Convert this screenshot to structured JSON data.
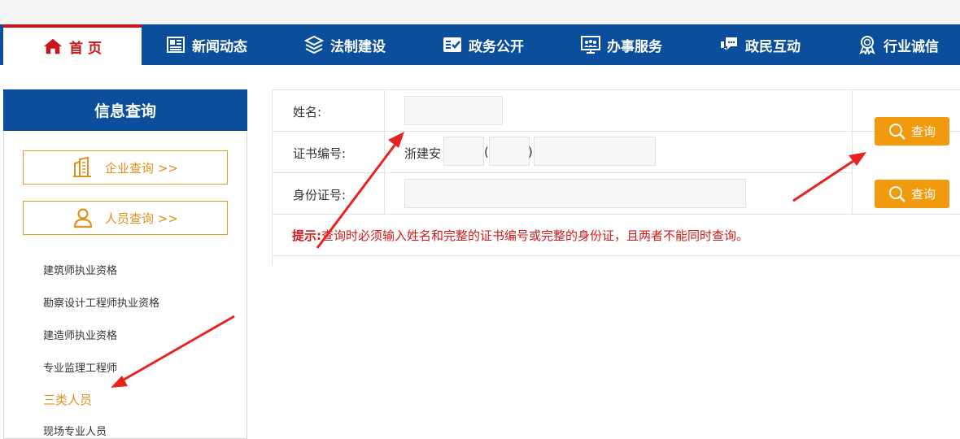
{
  "nav": {
    "items": [
      {
        "label": "首 页",
        "icon": "home-icon"
      },
      {
        "label": "新闻动态",
        "icon": "newspaper-icon"
      },
      {
        "label": "法制建设",
        "icon": "layers-icon"
      },
      {
        "label": "政务公开",
        "icon": "checkbox-card-icon"
      },
      {
        "label": "办事服务",
        "icon": "people-monitor-icon"
      },
      {
        "label": "政民互动",
        "icon": "chat-icon"
      },
      {
        "label": "行业诚信",
        "icon": "badge-icon"
      }
    ]
  },
  "sidebar": {
    "title": "信息查询",
    "company_btn": "企业查询 >>",
    "person_btn": "人员查询 >>",
    "links": [
      "建筑师执业资格",
      "勘察设计工程师执业资格",
      "建造师执业资格",
      "专业监理工程师",
      "三类人员",
      "现场专业人员"
    ]
  },
  "form": {
    "name_label": "姓名:",
    "cert_label": "证书编号:",
    "cert_prefix": "浙建安",
    "paren_open": "(",
    "paren_close": ")",
    "id_label": "身份证号:",
    "query_btn": "查询",
    "query_btn2": "查询",
    "tip_label": "提示:",
    "tip_text": "查询时必须输入姓名和完整的证书编号或完整的身份证，且两者不能同时查询。"
  },
  "colors": {
    "nav_blue": "#0b4f9c",
    "accent_orange": "#f19a0e",
    "active_red": "#c8161d",
    "annotation_red": "#e8231f"
  }
}
